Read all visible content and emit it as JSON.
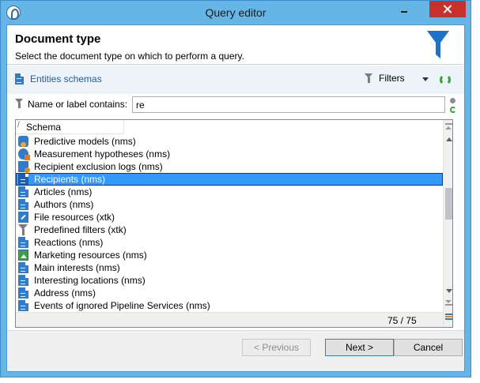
{
  "window": {
    "title": "Query editor"
  },
  "header": {
    "title": "Document type",
    "subtitle": "Select the document type on which to perform a query."
  },
  "toolbar": {
    "schema_link": "Entities schemas",
    "filters_label": "Filters"
  },
  "search": {
    "label": "Name or label contains:",
    "value": "re"
  },
  "list": {
    "column_header": "Schema",
    "items": [
      {
        "label": "Predictive models (nms)",
        "icon": "predictive-model-icon"
      },
      {
        "label": "Measurement hypotheses (nms)",
        "icon": "hypothesis-icon"
      },
      {
        "label": "Recipient exclusion logs (nms)",
        "icon": "exclusion-log-icon"
      },
      {
        "label": "Recipients (nms)",
        "icon": "schema-doc-icon",
        "selected": true
      },
      {
        "label": "Articles (nms)",
        "icon": "schema-doc-icon"
      },
      {
        "label": "Authors (nms)",
        "icon": "schema-doc-icon"
      },
      {
        "label": "File resources (xtk)",
        "icon": "file-resource-icon"
      },
      {
        "label": "Predefined filters (xtk)",
        "icon": "filter-icon"
      },
      {
        "label": "Reactions (nms)",
        "icon": "schema-doc-icon"
      },
      {
        "label": "Marketing resources (nms)",
        "icon": "image-icon"
      },
      {
        "label": "Main interests (nms)",
        "icon": "schema-doc-icon"
      },
      {
        "label": "Interesting locations (nms)",
        "icon": "schema-doc-icon"
      },
      {
        "label": "Address (nms)",
        "icon": "schema-doc-icon"
      },
      {
        "label": "Events of ignored Pipeline Services (nms)",
        "icon": "schema-doc-icon"
      }
    ],
    "count": "75 / 75"
  },
  "buttons": {
    "previous": "< Previous",
    "next": "Next >",
    "cancel": "Cancel"
  },
  "colors": {
    "titlebar": "#65b6e7",
    "selection": "#3399ff",
    "close": "#c7302b",
    "accent_blue": "#2f7bd0",
    "refresh_green": "#38a43a"
  }
}
